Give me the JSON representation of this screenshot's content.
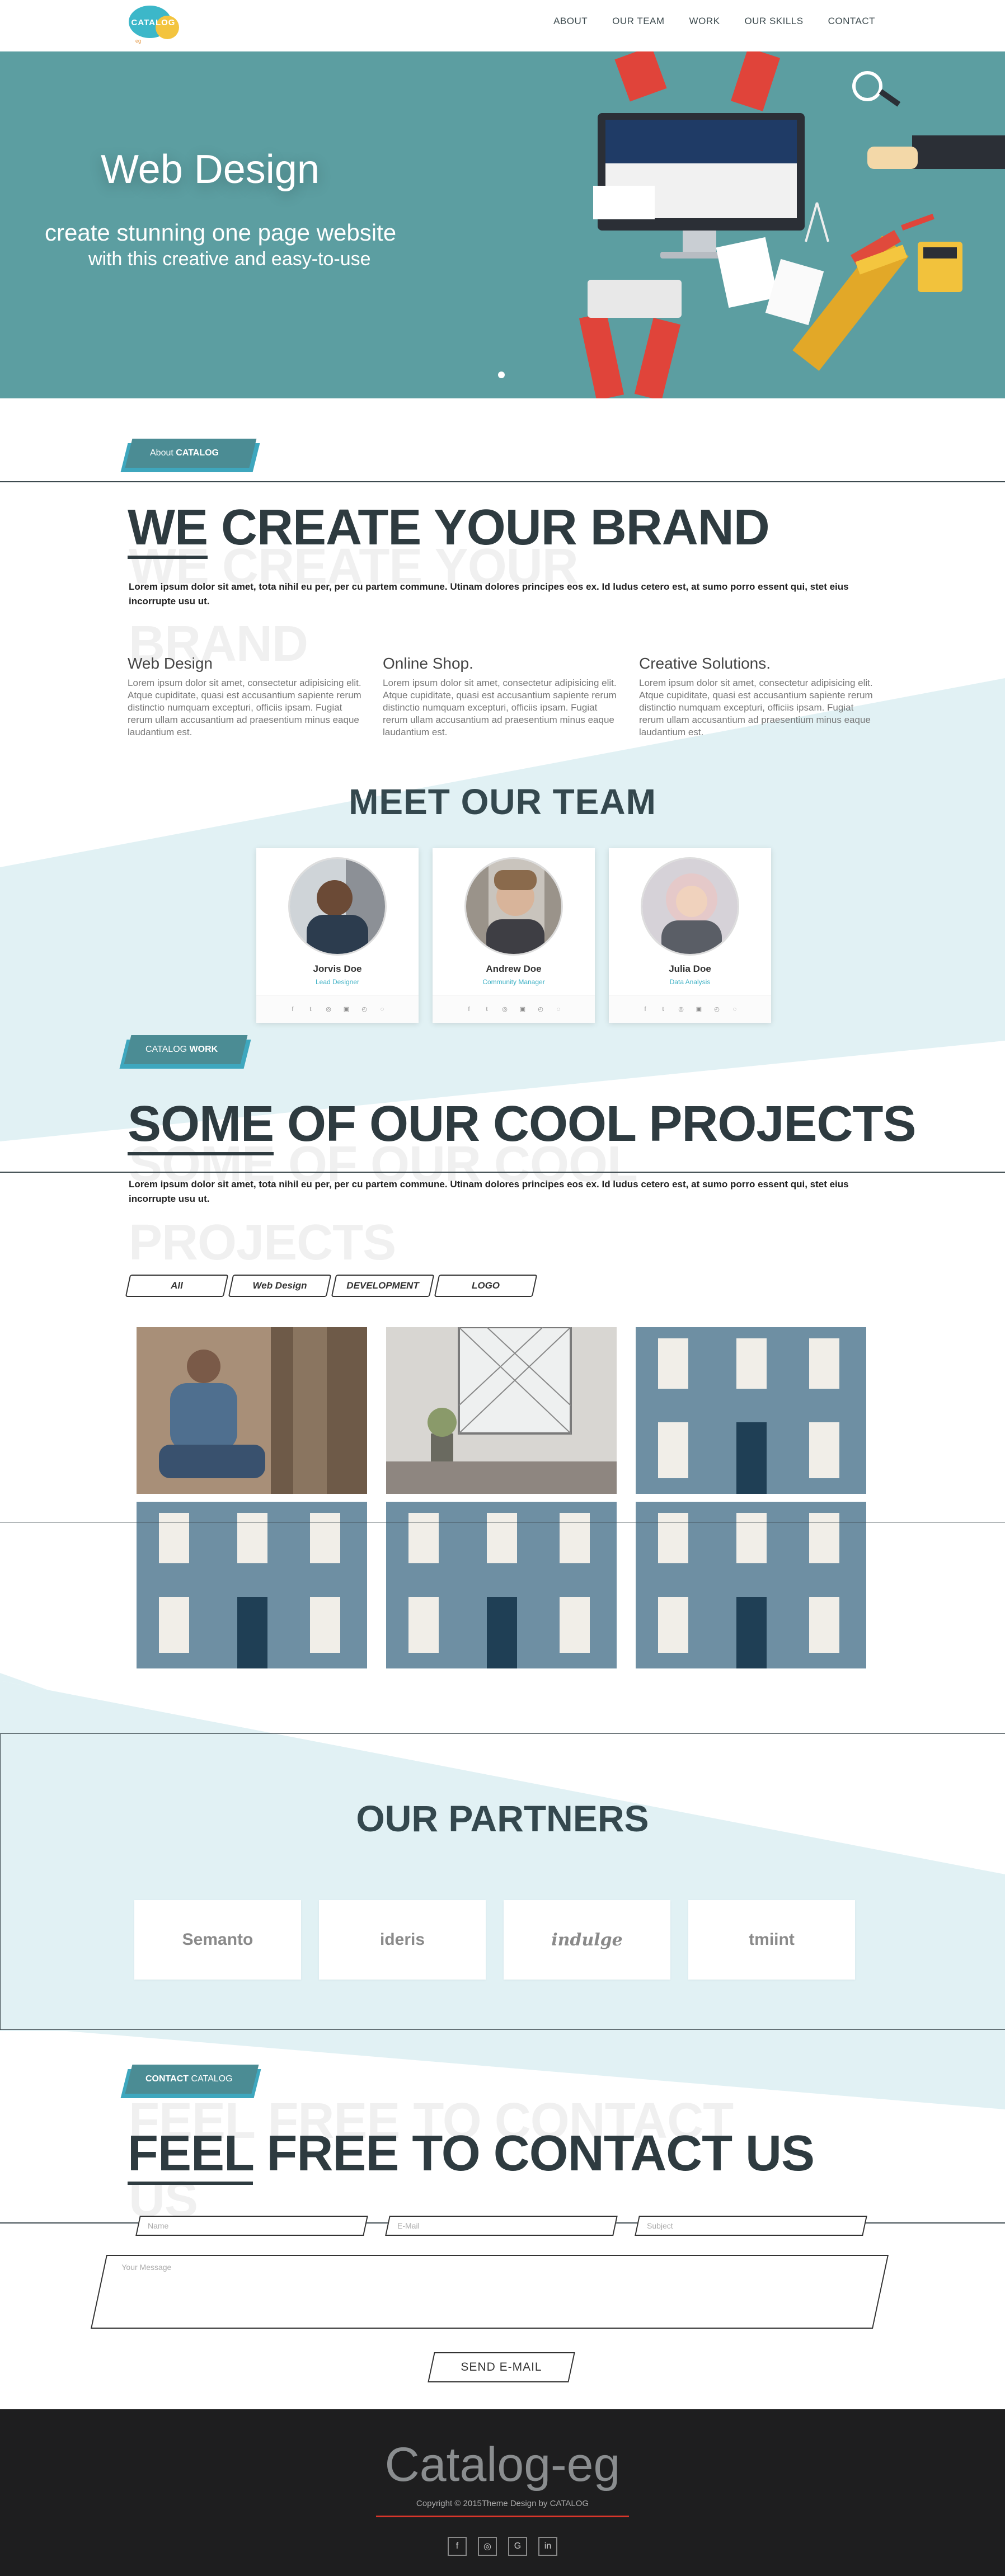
{
  "nav": {
    "logo_text": "CATALOG",
    "logo_sub": "eg",
    "items": [
      {
        "label": "ABOUT"
      },
      {
        "label": "OUR TEAM"
      },
      {
        "label": "WORK"
      },
      {
        "label": "OUR SKILLS"
      },
      {
        "label": "CONTACT"
      }
    ]
  },
  "hero": {
    "title": "Web Design",
    "line1": "create stunning one page website",
    "line2": "with this creative and easy-to-use"
  },
  "about": {
    "tag_prefix": "About ",
    "tag_bold": "CATALOG",
    "title_underlined": "WE",
    "title_rest": " CREATE YOUR BRAND",
    "ghost1": "WE CREATE YOUR",
    "ghost2": "BRAND",
    "lead": "Lorem ipsum dolor sit amet, tota nihil eu per, per cu partem commune. Utinam dolores principes eos ex. Id ludus cetero est, at sumo porro essent qui, stet eius incorrupte usu ut.",
    "services": [
      {
        "title": "Web Design",
        "text": "Lorem ipsum dolor sit amet, consectetur adipisicing elit. Atque cupiditate, quasi est accusantium sapiente rerum distinctio numquam excepturi, officiis ipsam. Fugiat rerum ullam accusantium ad praesentium minus eaque laudantium est."
      },
      {
        "title": "Online Shop.",
        "text": "Lorem ipsum dolor sit amet, consectetur adipisicing elit. Atque cupiditate, quasi est accusantium sapiente rerum distinctio numquam excepturi, officiis ipsam. Fugiat rerum ullam accusantium ad praesentium minus eaque laudantium est."
      },
      {
        "title": "Creative Solutions.",
        "text": "Lorem ipsum dolor sit amet, consectetur adipisicing elit. Atque cupiditate, quasi est accusantium sapiente rerum distinctio numquam excepturi, officiis ipsam. Fugiat rerum ullam accusantium ad praesentium minus eaque laudantium est."
      }
    ]
  },
  "team": {
    "title": "MEET OUR TEAM",
    "members": [
      {
        "name": "Jorvis Doe",
        "role": "Lead Designer"
      },
      {
        "name": "Andrew Doe",
        "role": "Community Manager"
      },
      {
        "name": "Julia Doe",
        "role": "Data Analysis"
      }
    ],
    "social": [
      "f",
      "t",
      "◎",
      "▣",
      "◴",
      "◌"
    ]
  },
  "work": {
    "tag_prefix": "CATALOG ",
    "tag_bold": "WORK",
    "title_underlined": "SOME",
    "title_rest": " OF OUR COOL PROJECTS",
    "ghost1": "SOME OF OUR COOL",
    "ghost2": "PROJECTS",
    "lead": "Lorem ipsum dolor sit amet, tota nihil eu per, per cu partem commune. Utinam dolores principes eos ex. Id ludus cetero est, at sumo porro essent qui, stet eius incorrupte usu ut.",
    "filters": [
      {
        "label": "All"
      },
      {
        "label": "Web Design"
      },
      {
        "label": "DEVELOPMENT"
      },
      {
        "label": "LOGO"
      }
    ]
  },
  "partners": {
    "title": "OUR PARTNERS",
    "logos": [
      {
        "name": "Semanto"
      },
      {
        "name": "ideris"
      },
      {
        "name": "indulge"
      },
      {
        "name": "tmiint"
      }
    ]
  },
  "contact": {
    "tag_bold": "CONTACT",
    "tag_suffix": " CATALOG",
    "title_underlined": "FEEL",
    "title_rest": " FREE TO CONTACT US",
    "ghost1": "FEEL FREE TO CONTACT",
    "ghost2": "US",
    "name_placeholder": "Name",
    "email_placeholder": "E-Mail",
    "subject_placeholder": "Subject",
    "message_placeholder": "Your Message",
    "send_label": "SEND E-MAIL"
  },
  "footer": {
    "brand": "Catalog-eg",
    "copyright": "Copyright © 2015Theme Design by CATALOG",
    "social": [
      "f",
      "◎",
      "G",
      "in"
    ]
  },
  "colors": {
    "hero": "#5c9ea1",
    "stripe": "#e1f1f4",
    "tag": "#4b8c94",
    "accent": "#3ea7be",
    "footer": "#1e1e1f",
    "footer_line": "#d9362b"
  }
}
